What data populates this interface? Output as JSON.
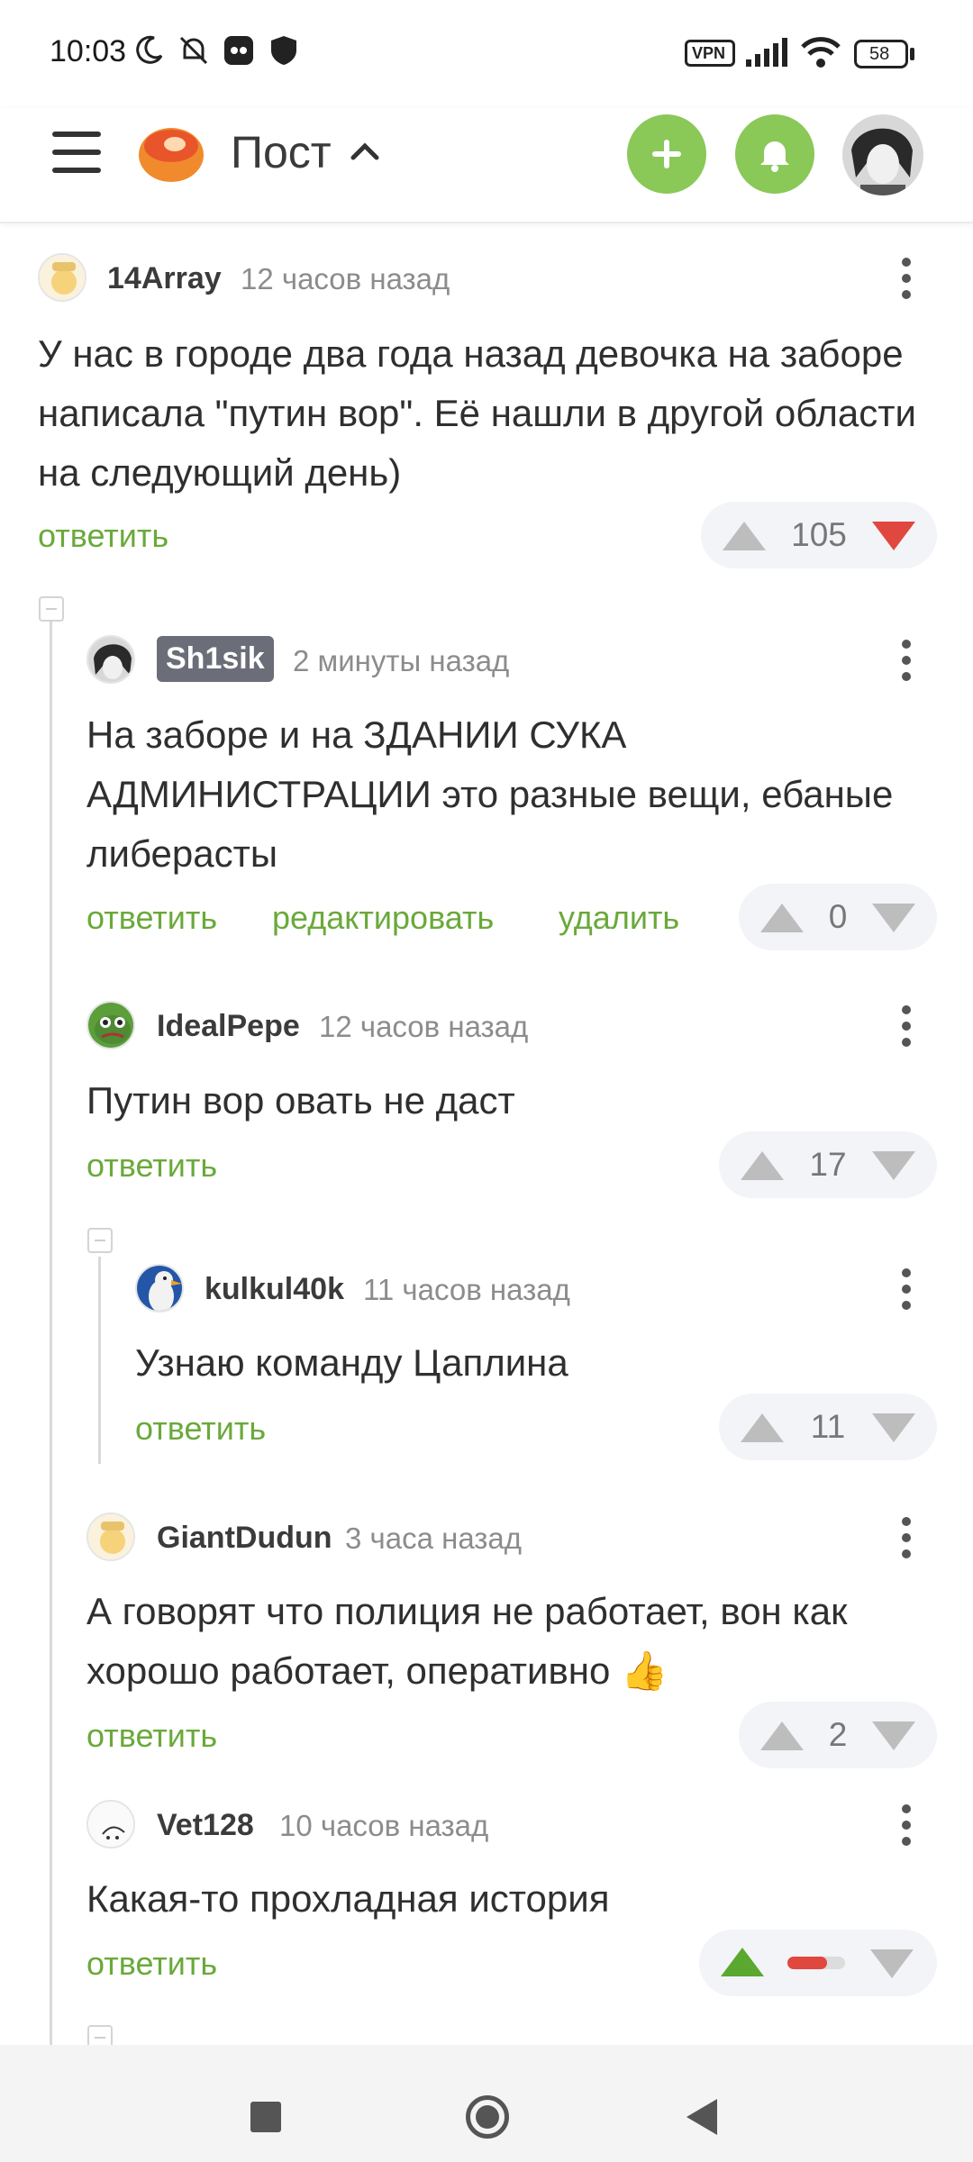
{
  "status_bar": {
    "time": "10:03",
    "vpn": "VPN",
    "battery": "58",
    "icons": [
      "moon-icon",
      "bell-off-icon",
      "app-icon",
      "shield-icon",
      "signal-icon",
      "wifi-icon",
      "battery-icon"
    ]
  },
  "header": {
    "title": "Пост",
    "menu_icon": "hamburger-icon",
    "logo_icon": "pikabu-logo-icon",
    "add_icon": "plus-icon",
    "notify_icon": "bell-icon",
    "accent": "#8ac858"
  },
  "comments": [
    {
      "user": "14Array",
      "time": "12 часов назад",
      "text": "У нас в городе два года назад девочка на заборе написала \"путин вор\". Её нашли в другой области на следующий день)",
      "reply": "ответить",
      "rating": "105"
    },
    {
      "user": "Sh1sik",
      "time": "2 минуты назад",
      "text": "На заборе и на ЗДАНИИ СУКА АДМИНИСТРАЦИИ это разные вещи, ебаные либерасты",
      "reply": "ответить",
      "edit": "редактировать",
      "delete": "удалить",
      "rating": "0"
    },
    {
      "user": "IdealPepe",
      "time": "12 часов назад",
      "text": "Путин вор овать не даст",
      "reply": "ответить",
      "rating": "17"
    },
    {
      "user": "kulkul40k",
      "time": "11 часов назад",
      "text": "Узнаю команду Цаплина",
      "reply": "ответить",
      "rating": "11"
    },
    {
      "user": "GiantDudun",
      "time": "3 часа назад",
      "text": "А говорят что полиция не работает, вон как хорошо работает, оперативно 👍",
      "reply": "ответить",
      "rating": "2"
    },
    {
      "user": "Vet128",
      "time": "10 часов назад",
      "text": "Какая-то прохладная история",
      "reply": "ответить"
    }
  ],
  "colors": {
    "link": "#6aa93a",
    "upvote_active": "#5aa82f",
    "downvote_active": "#e0473f",
    "neutral_vote": "#bdbdbd"
  }
}
